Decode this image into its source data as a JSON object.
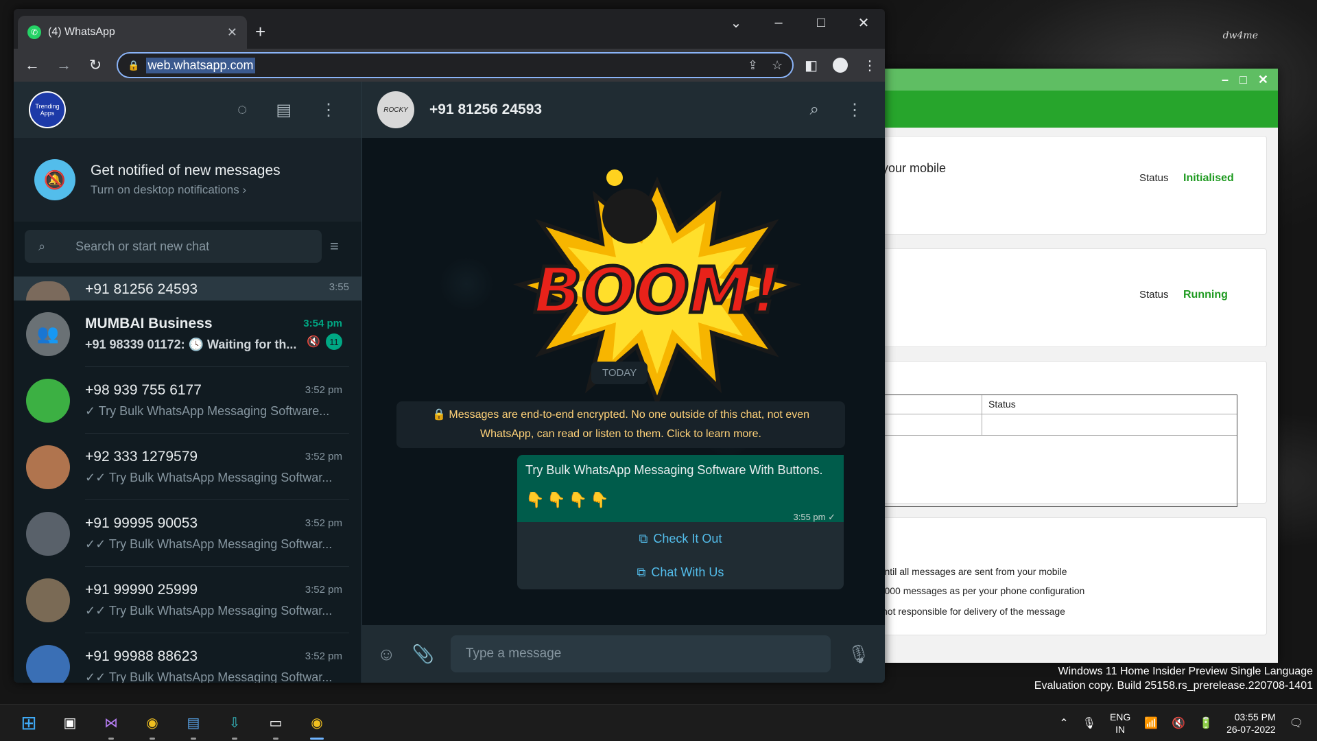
{
  "desktop": {
    "watermark": "dw4me"
  },
  "browser": {
    "tab_title": "(4) WhatsApp",
    "url": "web.whatsapp.com"
  },
  "whatsapp": {
    "my_avatar_text": "Trending Apps",
    "notify": {
      "title": "Get notified of new messages",
      "subtitle": "Turn on desktop notifications ›"
    },
    "search_placeholder": "Search or start new chat",
    "partial_chat": {
      "name": "+91 81256 24593",
      "time": "3:55"
    },
    "chats": [
      {
        "name": "MUMBAI Business",
        "time": "3:54 pm",
        "last": "+91 98339 01172: 🕓 Waiting for th...",
        "unread": "11",
        "bold": true
      },
      {
        "name": "+98 939 755 6177",
        "time": "3:52 pm",
        "last": "✓ Try Bulk WhatsApp Messaging Software..."
      },
      {
        "name": "+92 333 1279579",
        "time": "3:52 pm",
        "last": "✓✓ Try Bulk WhatsApp Messaging Softwar..."
      },
      {
        "name": "+91 99995 90053",
        "time": "3:52 pm",
        "last": "✓✓ Try Bulk WhatsApp Messaging Softwar..."
      },
      {
        "name": "+91 99990 25999",
        "time": "3:52 pm",
        "last": "✓✓ Try Bulk WhatsApp Messaging Softwar..."
      },
      {
        "name": "+91 99988 88623",
        "time": "3:52 pm",
        "last": "✓✓ Try Bulk WhatsApp Messaging Softwar..."
      }
    ],
    "conversation": {
      "contact": "+91 81256 24593",
      "contact_avatar_text": "ROCKY",
      "boom_text": "BOOM!",
      "date_chip": "TODAY",
      "encryption_note": "Messages are end-to-end encrypted. No one outside of this chat, not even WhatsApp, can read or listen to them. Click to learn more.",
      "message": {
        "text": "Try Bulk WhatsApp Messaging Software With Buttons.",
        "emoji": "👇👇👇👇",
        "time": "3:55 pm ✓"
      },
      "buttons": [
        "Check It Out",
        "Chat With Us"
      ],
      "input_placeholder": "Type a message"
    }
  },
  "bg_app": {
    "panel1_text": "n your mobile",
    "status_label": "Status",
    "status1": "Initialised",
    "status2": "Running",
    "table_header": "Status",
    "notes": [
      "d until all messages are sent from your mobile",
      "/20000 messages as per your phone configuration",
      "is not responsible for delivery of the message"
    ]
  },
  "windows_notice": {
    "line1": "Windows 11 Home Insider Preview Single Language",
    "line2": "Evaluation copy. Build 25158.rs_prerelease.220708-1401"
  },
  "tray": {
    "lang1": "ENG",
    "lang2": "IN",
    "time": "03:55 PM",
    "date": "26-07-2022"
  },
  "colors": {
    "accent": "#00a884",
    "bubble": "#005c4b",
    "link": "#53bdeb"
  }
}
